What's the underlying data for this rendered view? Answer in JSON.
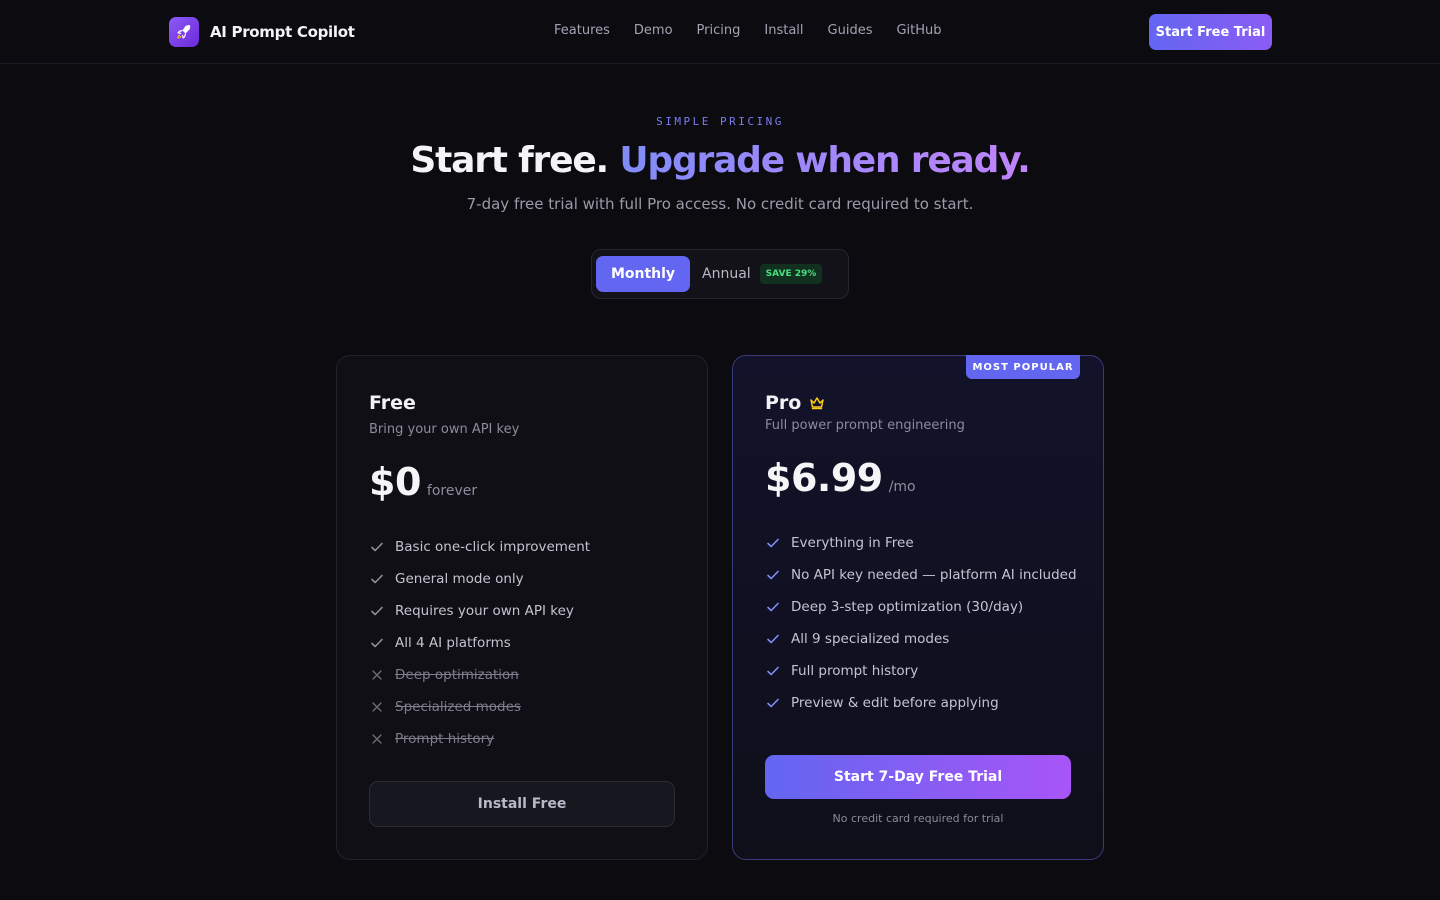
{
  "nav": {
    "brand": "AI Prompt Copilot",
    "links": [
      "Features",
      "Demo",
      "Pricing",
      "Install",
      "Guides",
      "GitHub"
    ],
    "cta": "Start Free Trial"
  },
  "hero": {
    "eyebrow": "SIMPLE PRICING",
    "headline_plain": "Start free.",
    "headline_accent": "Upgrade when ready.",
    "subhead": "7-day free trial with full Pro access. No credit card required to start."
  },
  "billing_toggle": {
    "monthly_label": "Monthly",
    "annual_label": "Annual",
    "save_badge": "SAVE 29%",
    "selected": "Monthly"
  },
  "plans": {
    "free": {
      "name": "Free",
      "description": "Bring your own API key",
      "price": "$0",
      "period": "forever",
      "features": [
        {
          "text": "Basic one-click improvement",
          "included": true
        },
        {
          "text": "General mode only",
          "included": true
        },
        {
          "text": "Requires your own API key",
          "included": true
        },
        {
          "text": "All 4 AI platforms",
          "included": true
        },
        {
          "text": "Deep optimization",
          "included": false
        },
        {
          "text": "Specialized modes",
          "included": false
        },
        {
          "text": "Prompt history",
          "included": false
        }
      ],
      "button": "Install Free"
    },
    "pro": {
      "badge": "MOST POPULAR",
      "name": "Pro",
      "description": "Full power prompt engineering",
      "price": "$6.99",
      "period": "/mo",
      "features": [
        {
          "text": "Everything in Free",
          "included": true
        },
        {
          "text": "No API key needed — platform AI included",
          "included": true
        },
        {
          "text": "Deep 3-step optimization (30/day)",
          "included": true
        },
        {
          "text": "All 9 specialized modes",
          "included": true
        },
        {
          "text": "Full prompt history",
          "included": true
        },
        {
          "text": "Preview & edit before applying",
          "included": true
        }
      ],
      "button": "Start 7-Day Free Trial",
      "fineprint": "No credit card required for trial"
    }
  },
  "colors": {
    "background": "#0b0b10",
    "accent": "#6366f1",
    "accent_secondary": "#a855f7",
    "check": "#818cf8",
    "save_green": "#4ade80",
    "crown_gold": "#facc15"
  },
  "icons": {
    "brand": "rocket-icon",
    "included": "check-icon",
    "excluded": "x-icon",
    "pro": "crown-icon"
  }
}
